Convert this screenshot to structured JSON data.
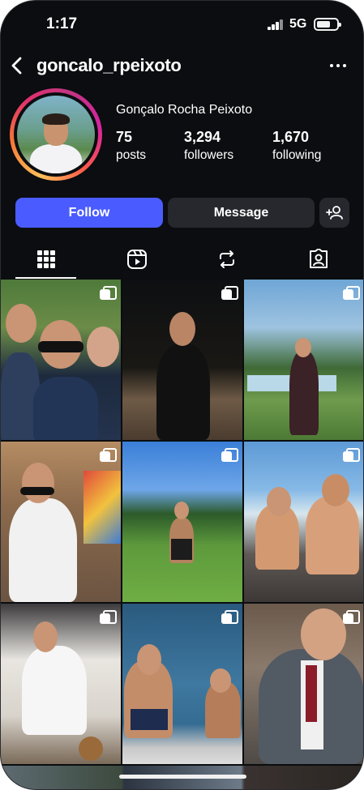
{
  "status_bar": {
    "time": "1:17",
    "network": "5G"
  },
  "header": {
    "username": "goncalo_rpeixoto",
    "back_icon": "chevron-left-icon",
    "more_icon": "ellipsis-icon"
  },
  "profile": {
    "full_name": "Gonçalo Rocha Peixoto",
    "ring_colors": [
      "#fdc05a",
      "#f77737",
      "#e1306c",
      "#c13584"
    ],
    "stats": {
      "posts": {
        "value": "75",
        "label": "posts"
      },
      "followers": {
        "value": "3,294",
        "label": "followers"
      },
      "following": {
        "value": "1,670",
        "label": "following"
      }
    }
  },
  "actions": {
    "follow": "Follow",
    "message": "Message",
    "add_person_icon": "add-person-icon",
    "follow_color": "#4a5cff"
  },
  "tabs": [
    {
      "name": "posts",
      "icon": "grid-icon",
      "active": true
    },
    {
      "name": "reels",
      "icon": "reels-icon",
      "active": false
    },
    {
      "name": "reposts",
      "icon": "repost-icon",
      "active": false
    },
    {
      "name": "tagged",
      "icon": "tagged-icon",
      "active": false
    }
  ],
  "grid_posts": [
    {
      "id": "post-1",
      "multi": true
    },
    {
      "id": "post-2",
      "multi": true
    },
    {
      "id": "post-3",
      "multi": true
    },
    {
      "id": "post-4",
      "multi": true
    },
    {
      "id": "post-5",
      "multi": true
    },
    {
      "id": "post-6",
      "multi": true
    },
    {
      "id": "post-7",
      "multi": true
    },
    {
      "id": "post-8",
      "multi": true
    },
    {
      "id": "post-9",
      "multi": true
    }
  ]
}
